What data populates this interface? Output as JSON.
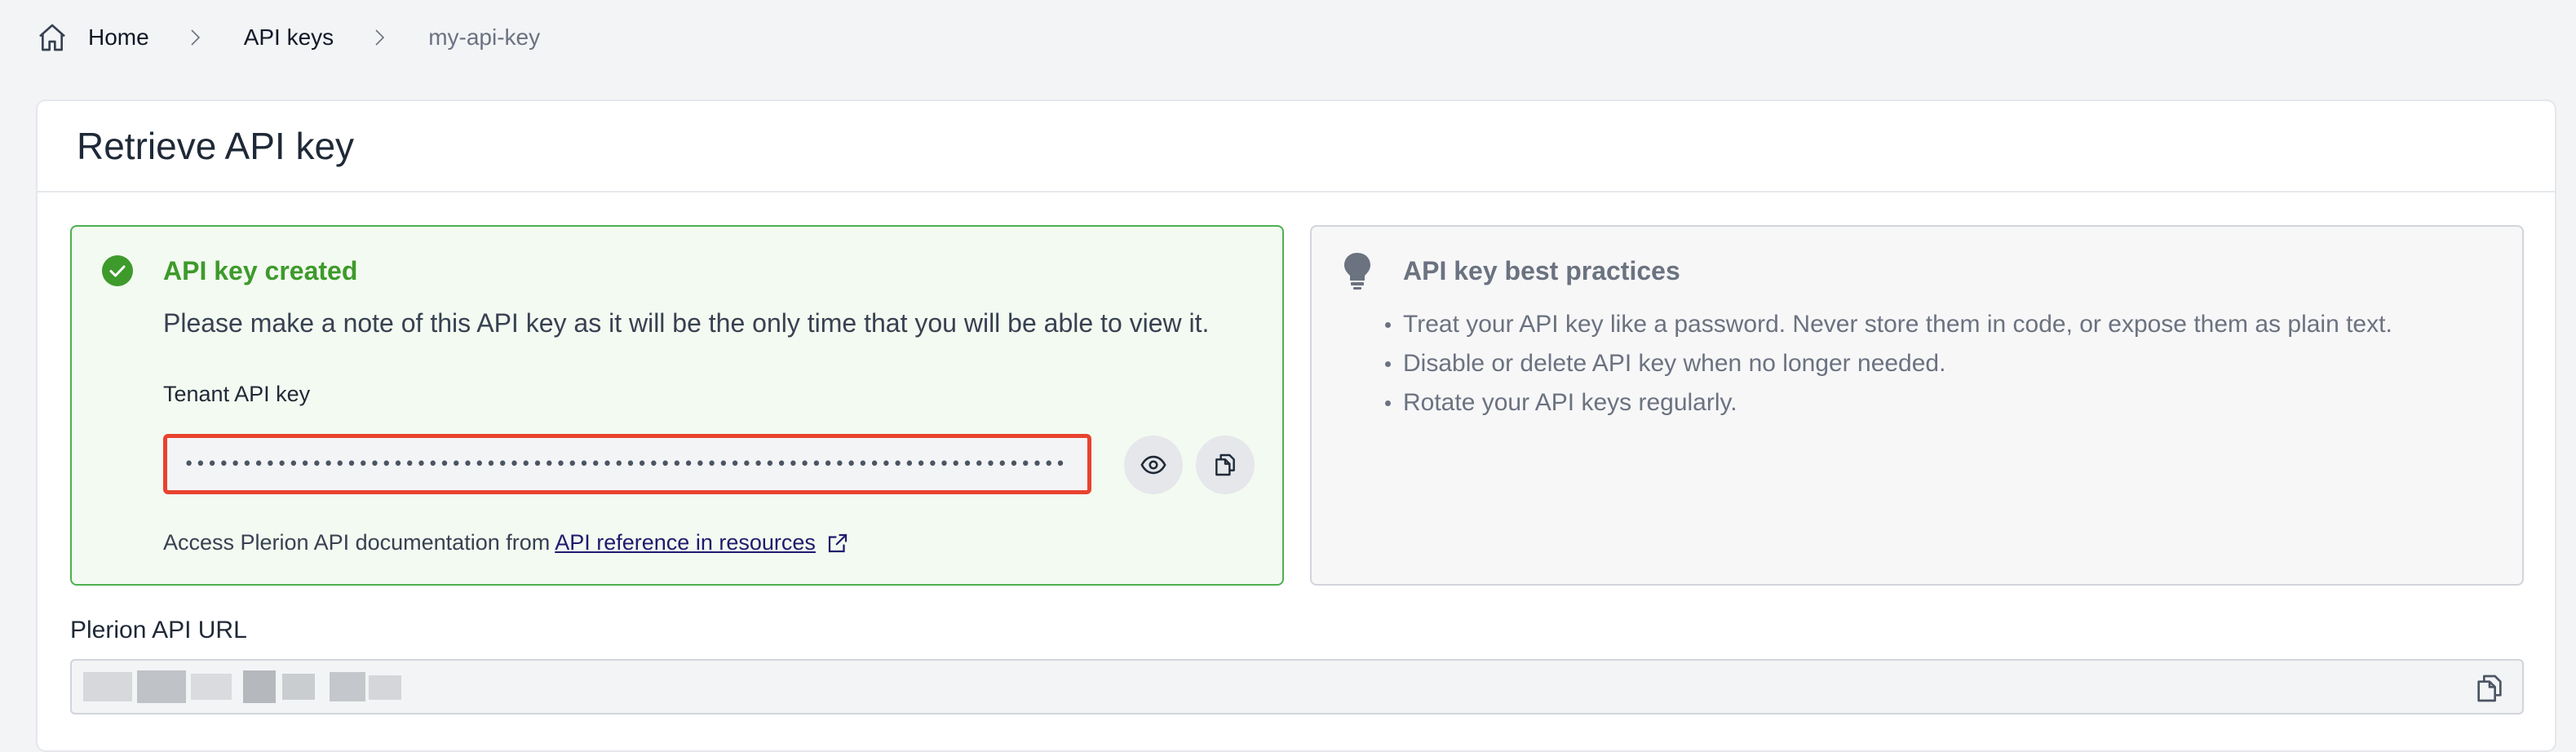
{
  "breadcrumb": {
    "home": "Home",
    "api_keys": "API keys",
    "current": "my-api-key"
  },
  "page": {
    "title": "Retrieve API key"
  },
  "success": {
    "title": "API key created",
    "message": "Please make a note of this API key as it will be the only time that you will be able to view it.",
    "key_label": "Tenant API key",
    "key_value": "••••••••••••••••••••••••••••••••••••••••••••••••••••••••••••••••••••••••••••",
    "doc_prefix": "Access Plerion API documentation from",
    "doc_link": "API reference in resources"
  },
  "tips": {
    "title": "API key best practices",
    "items": [
      "Treat your API key like a password. Never store them in code, or expose them as plain text.",
      "Disable or delete API key when no longer needed.",
      "Rotate your API keys regularly."
    ]
  },
  "url": {
    "label": "Plerion API URL"
  },
  "icons": {
    "home": "home-icon",
    "separator": "chevron-right-icon",
    "success": "check-circle-icon",
    "reveal": "eye-icon",
    "copy": "copy-icon",
    "external": "external-link-icon",
    "tip": "lightbulb-icon"
  },
  "colors": {
    "success_accent": "#3d9a2b",
    "success_border": "#4caf50",
    "highlight_border": "#e8432f",
    "link": "#1e1b6e"
  }
}
